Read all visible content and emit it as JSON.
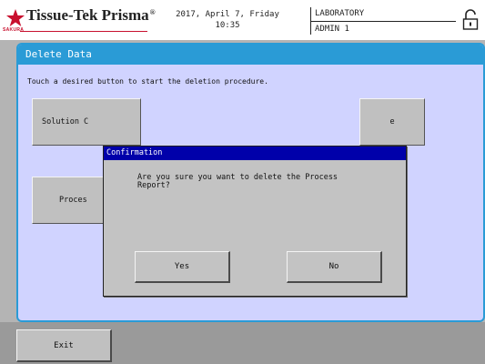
{
  "header": {
    "brand_name": "Tissue-Tek Prisma",
    "brand_mark": "®",
    "brand_sub": "SAKURA",
    "date": "2017, April 7, Friday",
    "time": "10:35",
    "department": "LABORATORY",
    "user": "ADMIN 1",
    "logo_icon": "sakura-star-icon",
    "lock_icon": "padlock-icon",
    "brand_color": "#c8102e"
  },
  "screen": {
    "title": "Delete Data",
    "instruction": "Touch a desired button to start the deletion procedure.",
    "buttons": [
      {
        "label": "Solution C"
      },
      {
        "label": "Proces"
      },
      {
        "label": "e"
      }
    ],
    "accent_color": "#2a9bd6",
    "panel_color": "#d0d3ff"
  },
  "dialog": {
    "title": "Confirmation",
    "message_line1": "Are you sure you want to delete the Process",
    "message_line2": "Report?",
    "yes_label": "Yes",
    "no_label": "No",
    "titlebar_color": "#0000aa"
  },
  "footer": {
    "exit_label": "Exit"
  }
}
